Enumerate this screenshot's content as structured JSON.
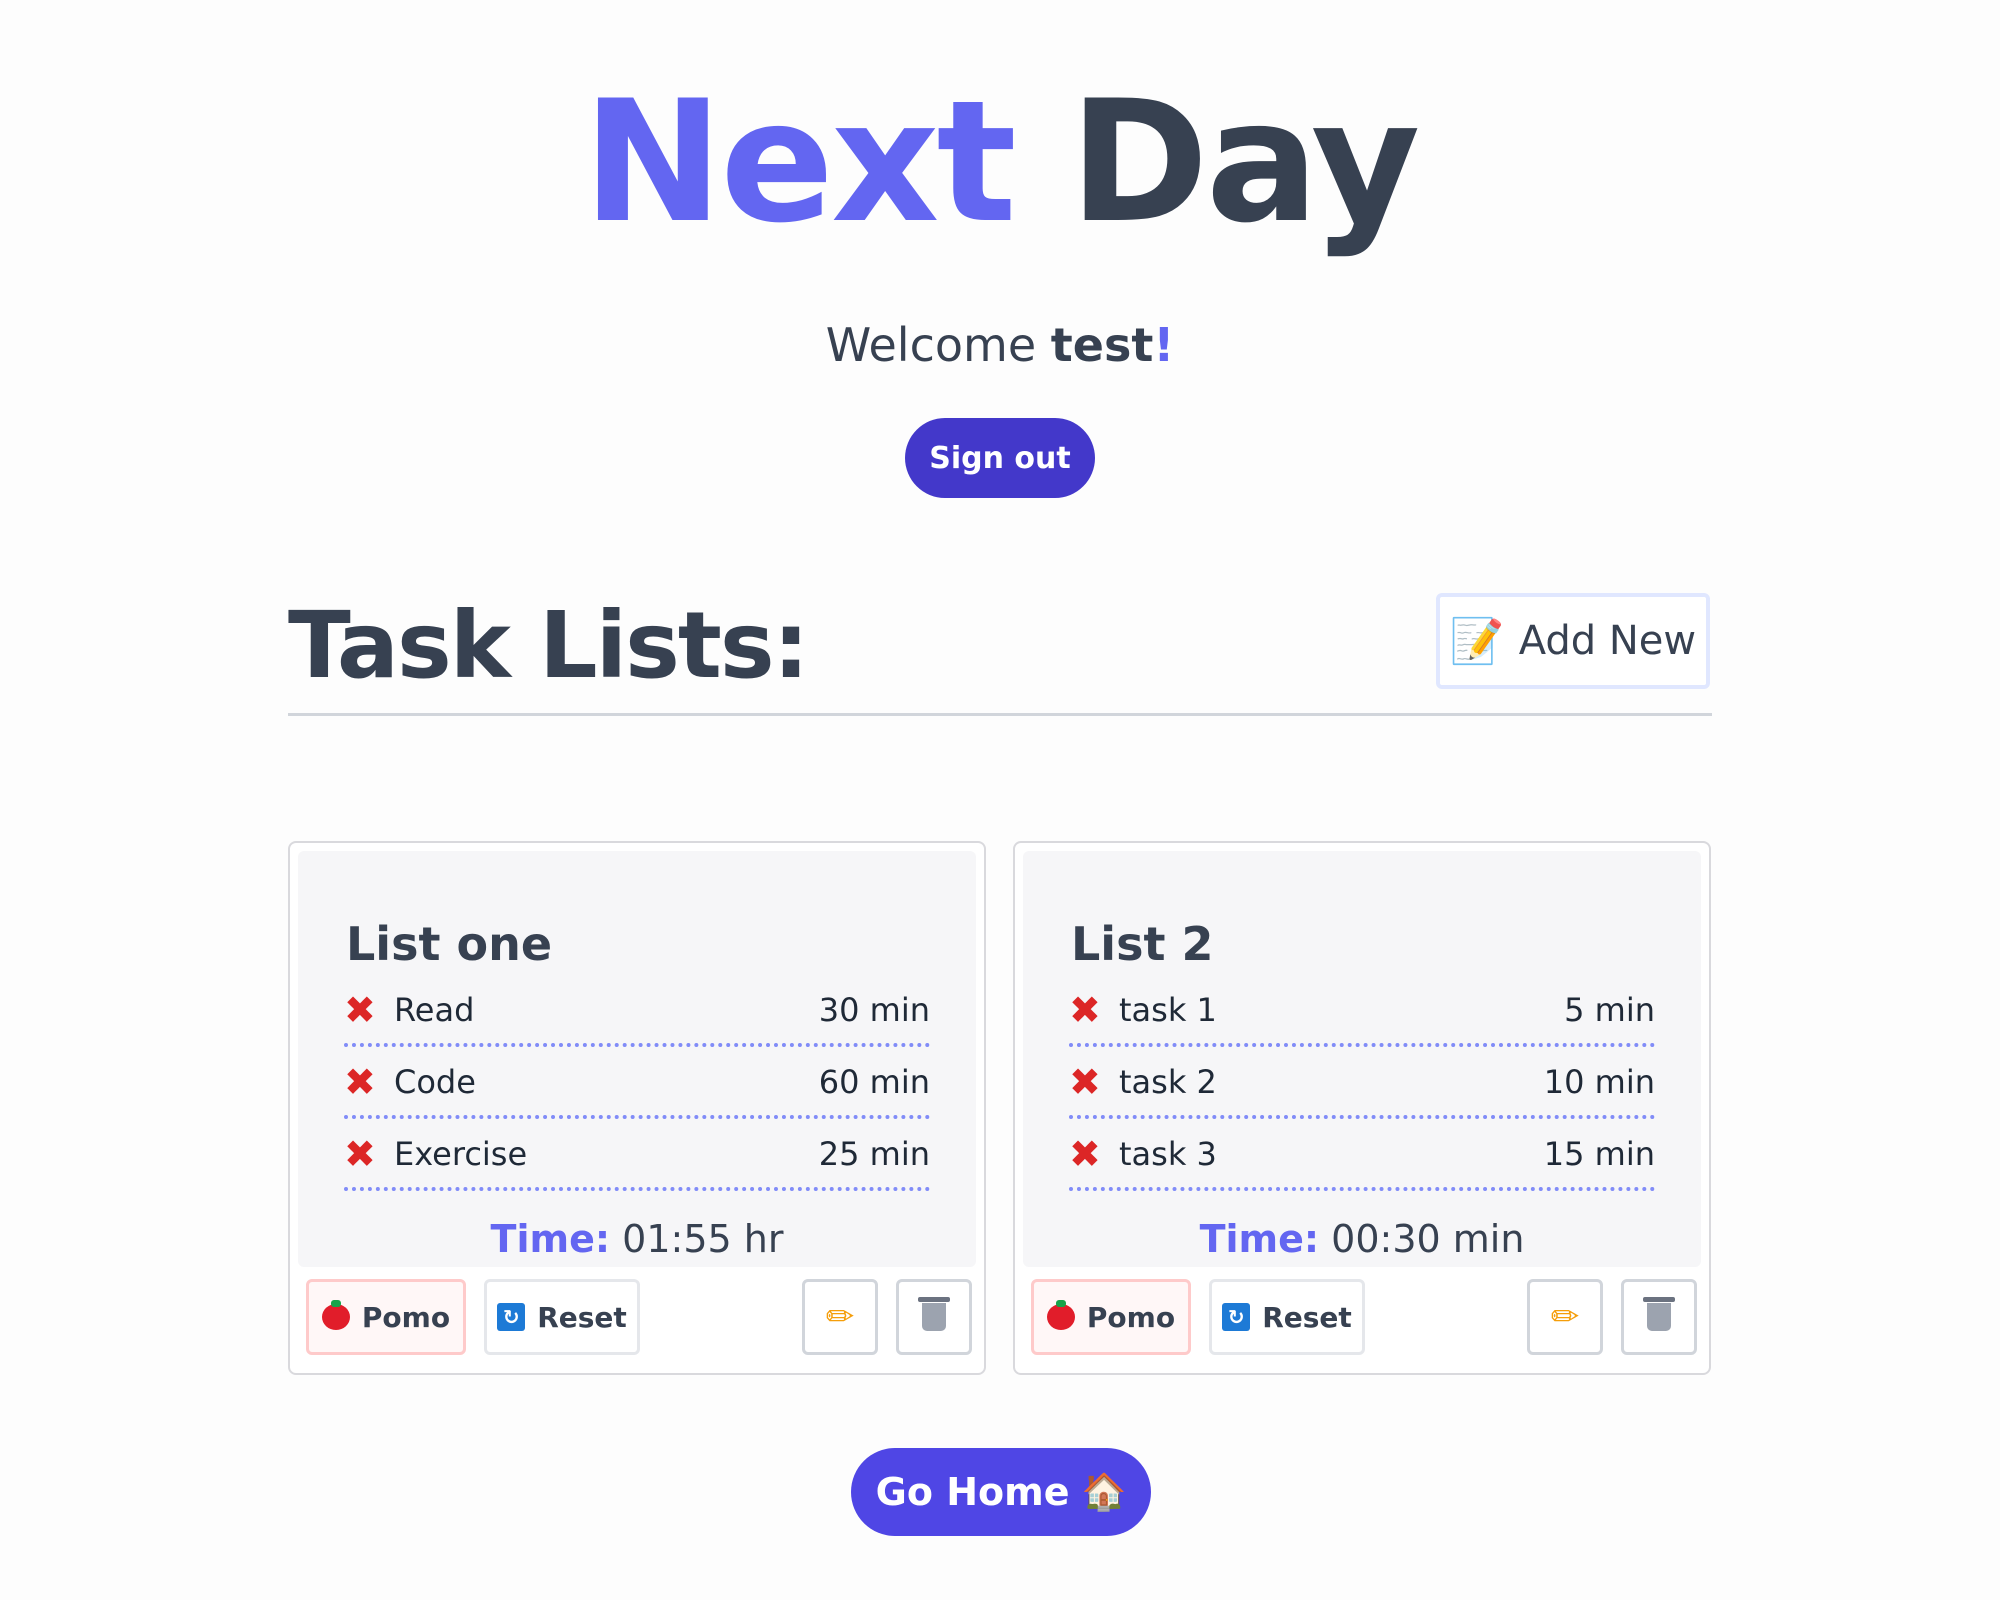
{
  "header": {
    "title_part1": "Next",
    "title_part2": "Day",
    "welcome_prefix": "Welcome",
    "username": "test",
    "welcome_suffix": "!",
    "signout_label": "Sign out"
  },
  "section": {
    "title": "Task Lists:",
    "add_new_label": "Add New",
    "add_new_icon": "memo-icon"
  },
  "lists": [
    {
      "title": "List one",
      "tasks": [
        {
          "name": "Read",
          "duration": "30 min"
        },
        {
          "name": "Code",
          "duration": "60 min"
        },
        {
          "name": "Exercise",
          "duration": "25 min"
        }
      ],
      "time_label": "Time:",
      "time_value": "01:55 hr"
    },
    {
      "title": "List 2",
      "tasks": [
        {
          "name": "task 1",
          "duration": "5 min"
        },
        {
          "name": "task 2",
          "duration": "10 min"
        },
        {
          "name": "task 3",
          "duration": "15 min"
        }
      ],
      "time_label": "Time:",
      "time_value": "00:30 min"
    }
  ],
  "buttons": {
    "pomo_label": "Pomo",
    "reset_label": "Reset"
  },
  "footer": {
    "go_home_label": "Go Home"
  },
  "colors": {
    "accent": "#6366f1",
    "primary_button": "#4338ca",
    "text": "#374151",
    "remove_x": "#dc2626"
  }
}
